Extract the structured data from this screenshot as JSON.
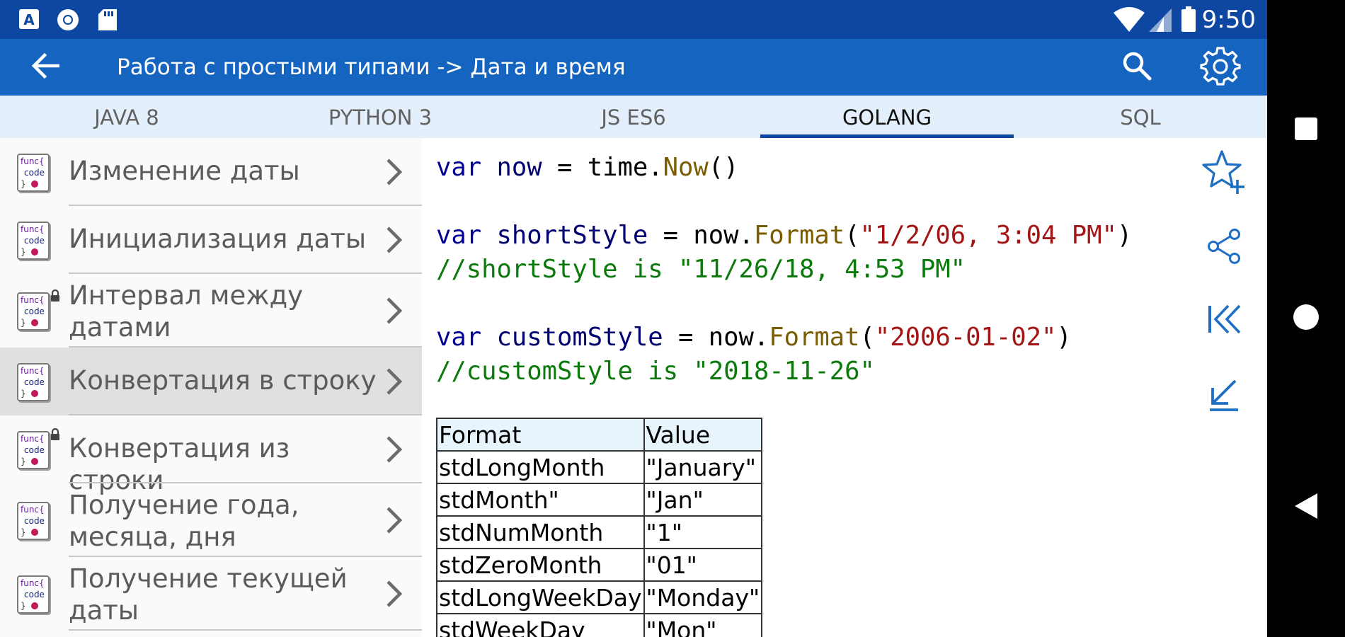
{
  "status_bar": {
    "time": "9:50",
    "left_icons": [
      "font-notification-icon",
      "chrome-notification-icon",
      "sd-card-icon"
    ],
    "right_icons": [
      "wifi-icon",
      "signal-icon",
      "battery-icon"
    ]
  },
  "app_bar": {
    "title": "Работа с простыми типами -> Дата и время",
    "back_icon": "arrow-back-icon",
    "search_icon": "search-icon",
    "settings_icon": "gear-icon"
  },
  "tabs": [
    {
      "label": "JAVA 8",
      "active": false
    },
    {
      "label": "PYTHON 3",
      "active": false
    },
    {
      "label": "JS ES6",
      "active": false
    },
    {
      "label": "GOLANG",
      "active": true
    },
    {
      "label": "SQL",
      "active": false
    }
  ],
  "func_icon": {
    "line1": "func{",
    "line2": "code",
    "line3": "}"
  },
  "sidebar": {
    "items": [
      {
        "label": "Изменение даты",
        "locked": false,
        "selected": false
      },
      {
        "label": "Инициализация даты",
        "locked": false,
        "selected": false
      },
      {
        "label": "Интервал между датами",
        "locked": true,
        "selected": false
      },
      {
        "label": "Конвертация в строку",
        "locked": false,
        "selected": true
      },
      {
        "label": "Конвертация из строки",
        "locked": true,
        "selected": false
      },
      {
        "label": "Получение года, месяца, дня",
        "locked": false,
        "selected": false
      },
      {
        "label": "Получение текущей даты",
        "locked": false,
        "selected": false
      }
    ]
  },
  "code": {
    "line1": {
      "kw": "var",
      "ident": "now",
      "op": " = time.",
      "fn": "Now",
      "tail": "()"
    },
    "line2": {
      "kw": "var",
      "ident": "shortStyle",
      "op": " = now.",
      "fn": "Format",
      "open": "(",
      "str": "\"1/2/06, 3:04 PM\"",
      "close": ")"
    },
    "line3": {
      "comment": "//shortStyle is \"11/26/18, 4:53 PM\""
    },
    "line4": {
      "kw": "var",
      "ident": "customStyle",
      "op": " = now.",
      "fn": "Format",
      "open": "(",
      "str": "\"2006-01-02\"",
      "close": ")"
    },
    "line5": {
      "comment": "//customStyle is \"2018-11-26\""
    }
  },
  "format_table": {
    "headers": [
      "Format",
      "Value"
    ],
    "rows": [
      [
        "stdLongMonth",
        "\"January\""
      ],
      [
        "stdMonth\"",
        "\"Jan\""
      ],
      [
        "stdNumMonth",
        "\"1\""
      ],
      [
        "stdZeroMonth",
        "\"01\""
      ],
      [
        "stdLongWeekDay",
        "\"Monday\""
      ],
      [
        "stdWeekDay",
        "\"Mon\""
      ]
    ]
  },
  "actions": [
    {
      "icon": "star-add-icon"
    },
    {
      "icon": "share-icon"
    },
    {
      "icon": "first-page-icon"
    },
    {
      "icon": "download-icon"
    }
  ],
  "nav_bar": {
    "icons": [
      "recents-square-icon",
      "home-circle-icon",
      "back-triangle-icon"
    ]
  },
  "colors": {
    "status_bar": "#0d47a1",
    "app_bar": "#1565c0",
    "tab_strip": "#e3f0fc",
    "tab_indicator": "#0d47a1",
    "keyword": "#000096",
    "function": "#7b5c00",
    "string": "#a31515",
    "comment": "#0a7a0a",
    "action_icon": "#1e6fc4"
  }
}
